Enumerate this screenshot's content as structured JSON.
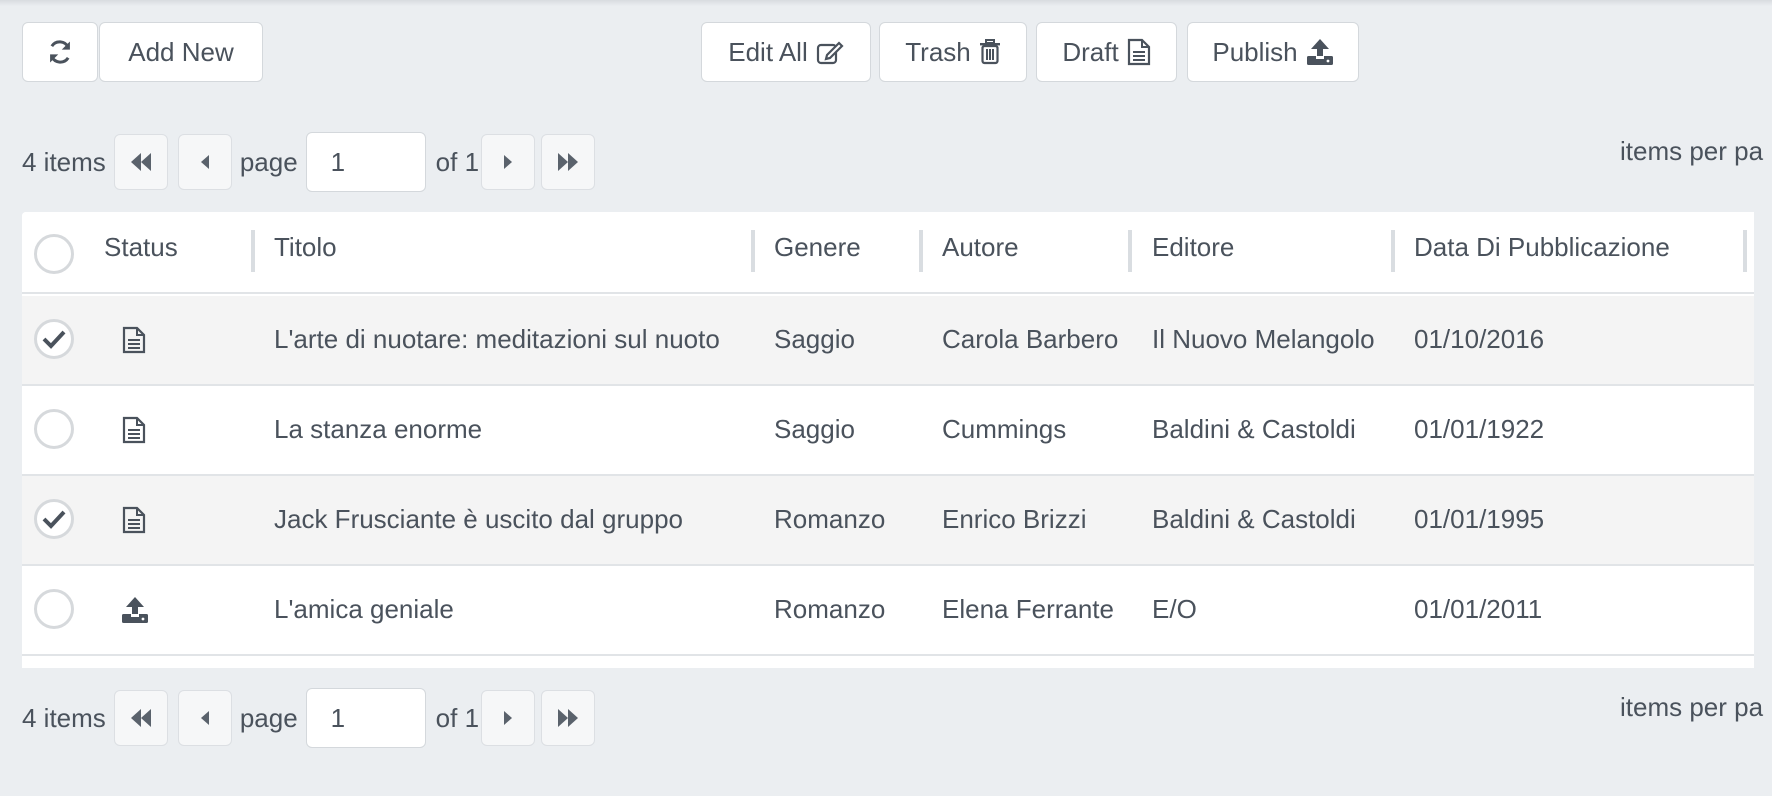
{
  "toolbar": {
    "add_new_label": "Add New",
    "edit_all_label": "Edit All",
    "trash_label": "Trash",
    "draft_label": "Draft",
    "publish_label": "Publish"
  },
  "pager": {
    "items_label": "4 items",
    "page_label": "page",
    "page_value": "1",
    "of_label": "of 1",
    "items_per_page_label": "items per pa"
  },
  "table": {
    "headers": {
      "status": "Status",
      "titolo": "Titolo",
      "genere": "Genere",
      "autore": "Autore",
      "editore": "Editore",
      "data": "Data Di Pubblicazione"
    },
    "rows": [
      {
        "checked": true,
        "status": "draft-icon",
        "titolo": "L'arte di nuotare: meditazioni sul nuoto",
        "genere": "Saggio",
        "autore": "Carola Barbero",
        "editore": "Il Nuovo Melangolo",
        "data": "01/10/2016"
      },
      {
        "checked": false,
        "status": "draft-icon",
        "titolo": "La stanza enorme",
        "genere": "Saggio",
        "autore": "Cummings",
        "editore": "Baldini & Castoldi",
        "data": "01/01/1922"
      },
      {
        "checked": true,
        "status": "draft-icon",
        "titolo": "Jack Frusciante è uscito dal gruppo",
        "genere": "Romanzo",
        "autore": "Enrico Brizzi",
        "editore": "Baldini & Castoldi",
        "data": "01/01/1995"
      },
      {
        "checked": false,
        "status": "publish-icon",
        "titolo": "L'amica geniale",
        "genere": "Romanzo",
        "autore": "Elena Ferrante",
        "editore": "E/O",
        "data": "01/01/2011"
      }
    ]
  }
}
